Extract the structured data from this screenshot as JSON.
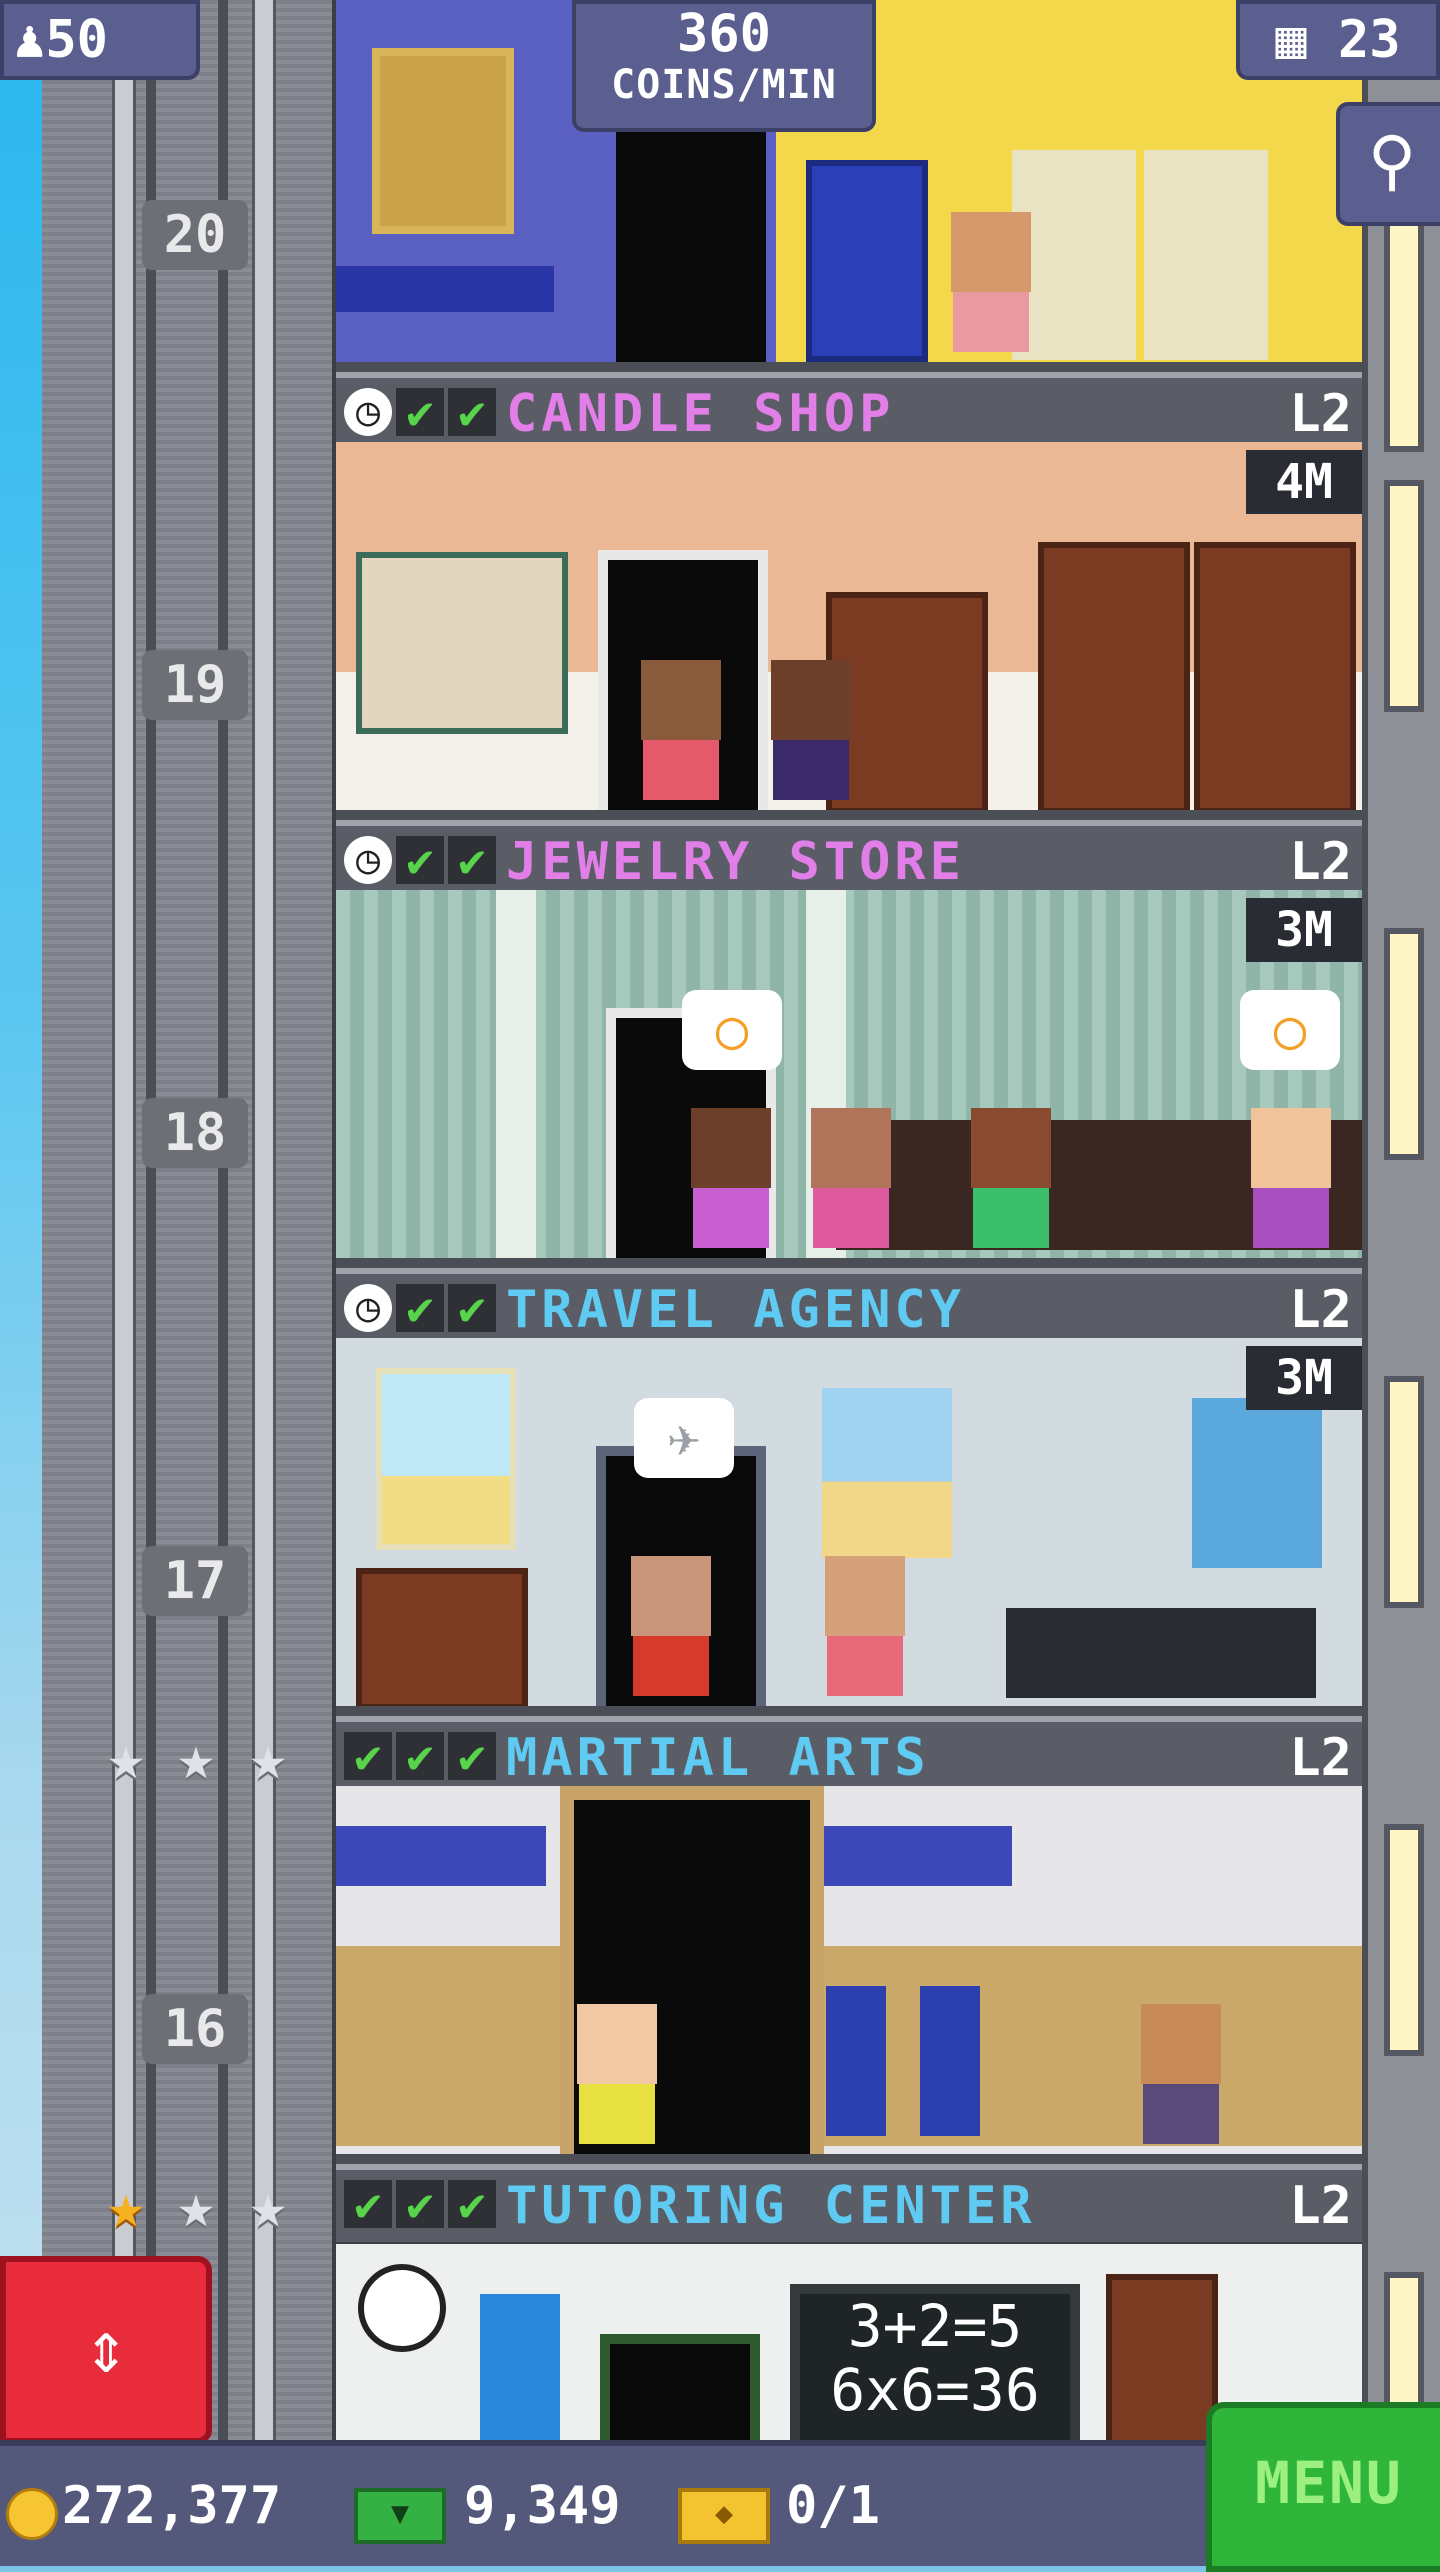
{
  "hud": {
    "population": "50",
    "coins_per_min_value": "360",
    "coins_per_min_unit": "COINS/MIN",
    "floor_count": "23"
  },
  "floors": [
    {
      "number": "20",
      "name": "",
      "level": "",
      "timer": ""
    },
    {
      "number": "19",
      "name": "CANDLE SHOP",
      "level": "L2",
      "timer": "4M"
    },
    {
      "number": "18",
      "name": "JEWELRY STORE",
      "level": "L2",
      "timer": "3M"
    },
    {
      "number": "17",
      "name": "TRAVEL AGENCY",
      "level": "L2",
      "timer": "3M"
    },
    {
      "number": "16",
      "name": "MARTIAL ARTS",
      "level": "L2",
      "timer": ""
    },
    {
      "number": "",
      "name": "TUTORING CENTER",
      "level": "L2",
      "timer": ""
    }
  ],
  "chalkboard": {
    "line1": "3+2=5",
    "line2": "6x6=36"
  },
  "bottom": {
    "coins": "272,377",
    "bux": "9,349",
    "golden_tickets": "0/1",
    "menu_label": "MENU"
  },
  "icons": [
    "person-icon",
    "floors-icon",
    "search-icon",
    "elevator-arrows-icon",
    "coin-icon",
    "bux-icon",
    "golden-ticket-icon",
    "check-icon",
    "clock-icon",
    "star-icon"
  ],
  "colors": {
    "name_pink": "#e27ee8",
    "name_blue": "#5fcbf2",
    "menu_green": "#2fb63a",
    "elevator_red": "#e82c3c"
  }
}
